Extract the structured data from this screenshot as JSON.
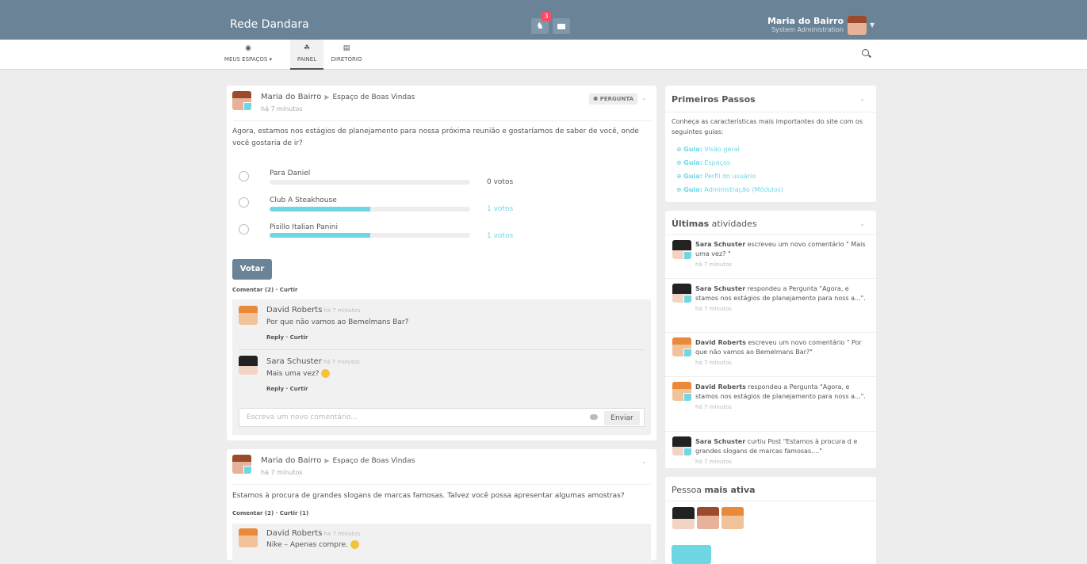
{
  "app": {
    "brand": "Rede Dandara",
    "notifications_count": "3"
  },
  "user": {
    "name": "Maria do Bairro",
    "role": "System Administration"
  },
  "nav": {
    "items": [
      {
        "label": "MEUS ESPAÇOS ▾",
        "icon": "dashboard-circle-icon"
      },
      {
        "label": "PAINEL",
        "icon": "tachometer-icon",
        "active": true
      },
      {
        "label": "DIRETÓRIO",
        "icon": "book-icon"
      }
    ]
  },
  "post1": {
    "author": "Maria do Bairro",
    "space": "Espaço de Boas Vindas",
    "time": "há 7 minutos",
    "label": "⚉ PERGUNTA",
    "question": "Agora, estamos nos estágios de planejamento para nossa próxima reunião e gostaríamos de saber de você, onde você gostaria de ir?",
    "options": [
      {
        "answer": "Para Daniel",
        "votes": "0 votos",
        "percent": 0
      },
      {
        "answer": "Club A Steakhouse",
        "votes": "1 votos",
        "percent": 50
      },
      {
        "answer": "Pisillo Italian Panini",
        "votes": "1 votos",
        "percent": 50
      }
    ],
    "vote_label": "Votar",
    "actions": "Comentar (2) · Curtir",
    "comments": [
      {
        "author": "David Roberts",
        "time": "há 7 minutos",
        "text": "Por que não vamos ao Bemelmans Bar?",
        "actions": "Reply · Curtir"
      },
      {
        "author": "Sara Schuster",
        "time": "há 7 minutos",
        "text": "Mais uma vez? ",
        "actions": "Reply · Curtir"
      }
    ],
    "comment_placeholder": "Escreva um novo comentário...",
    "send_label": "Enviar"
  },
  "post2": {
    "author": "Maria do Bairro",
    "space": "Espaço de Boas Vindas",
    "time": "há 7 minutos",
    "text": "Estamos à procura de grandes slogans de marcas famosas. Talvez você possa apresentar algumas amostras?",
    "actions": "Comentar (2) · Curtir (1)",
    "comments": [
      {
        "author": "David Roberts",
        "time": "há 7 minutos",
        "text": "Nike – Apenas compre. "
      }
    ]
  },
  "primeiros": {
    "title": "Primeiros Passos",
    "intro": "Conheça as características mais importantes do site com os seguintes guias:",
    "guides": [
      {
        "prefix": "Guia:",
        "label": "Visão geral"
      },
      {
        "prefix": "Guia:",
        "label": "Espaços"
      },
      {
        "prefix": "Guia:",
        "label": "Perfil do usuário"
      },
      {
        "prefix": "Guia:",
        "label": "Administração (Módulos)"
      }
    ]
  },
  "activities": {
    "title_bold": "Últimas",
    "title_rest": " atividades",
    "items": [
      {
        "who": "Sara Schuster",
        "text": " escreveu um novo comentário \" Mais uma vez? \"",
        "time": "há 7 minutos"
      },
      {
        "who": "Sara Schuster",
        "text": " respondeu a Pergunta \"Agora, e stamos nos estágios de planejamento para noss a...\".",
        "time": "há 7 minutos"
      },
      {
        "who": "David Roberts",
        "text": " escreveu um novo comentário \" Por que não vamos ao Bemelmans Bar?\"",
        "time": "há 7 minutos"
      },
      {
        "who": "David Roberts",
        "text": " respondeu a Pergunta \"Agora, e stamos nos estágios de planejamento para noss a...\".",
        "time": "há 7 minutos"
      },
      {
        "who": "Sara Schuster",
        "text": " curtiu Post \"Estamos à procura d e grandes slogans de marcas famosas....\"",
        "time": "há 7 minutos"
      }
    ]
  },
  "active_people": {
    "title_plain": "Pessoa ",
    "title_bold": "mais ativa"
  },
  "colors": {
    "header": "#6b8396",
    "accent": "#6fd6e4",
    "badge": "#fc4a64"
  }
}
